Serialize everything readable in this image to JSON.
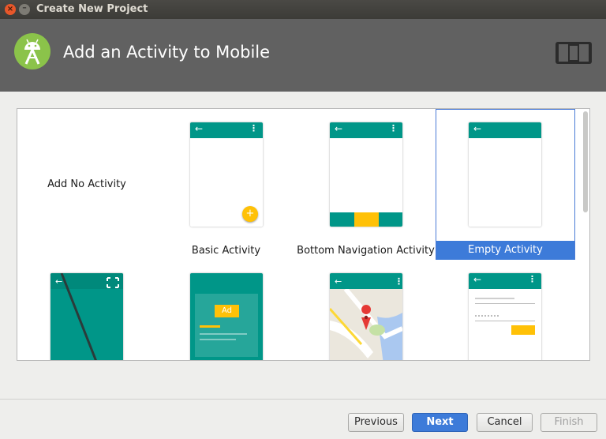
{
  "window": {
    "title": "Create New Project"
  },
  "header": {
    "title": "Add an Activity to Mobile"
  },
  "tiles": [
    {
      "label": "Add No Activity"
    },
    {
      "label": "Basic Activity",
      "fab": "+"
    },
    {
      "label": "Bottom Navigation Activity"
    },
    {
      "label": "Empty Activity",
      "selected": true
    },
    {
      "label": ""
    },
    {
      "label": "",
      "ad": "Ad"
    },
    {
      "label": ""
    },
    {
      "label": ""
    }
  ],
  "buttons": {
    "previous": "Previous",
    "next": "Next",
    "cancel": "Cancel",
    "finish": "Finish"
  },
  "colors": {
    "accent_teal": "#009688",
    "fab_amber": "#ffc107",
    "selection_blue": "#3d7bd9",
    "header_gray": "#616161"
  }
}
